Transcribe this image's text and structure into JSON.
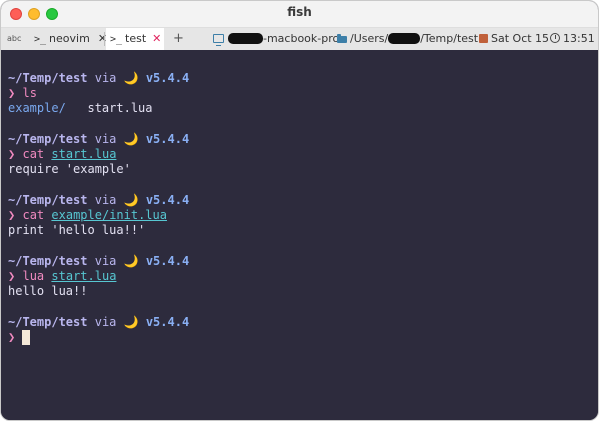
{
  "window": {
    "title": "fish"
  },
  "tabs": {
    "input_indicator": "abc",
    "items": [
      {
        "glyph": ">_",
        "label": "neovim",
        "close": "✕",
        "active": false
      },
      {
        "glyph": ">_",
        "label": "test",
        "close": "✕",
        "active": true
      }
    ],
    "new_tab": "+"
  },
  "status": {
    "host_suffix": "-macbook-pro",
    "path_prefix": "/Users/",
    "path_suffix": "/Temp/test",
    "date": "Sat Oct 15",
    "time": "13:51",
    "icons": {
      "host": "monitor-icon",
      "path": "folder-icon",
      "date": "calendar-icon",
      "time": "clock-icon"
    },
    "colors": {
      "close_x": "#e0245e",
      "icon": "#3d7fa8"
    }
  },
  "terminal": {
    "background": "#2d2b3d",
    "prompt_char": "❯",
    "prompt": {
      "path": "~/Temp/test",
      "via": "via",
      "moon": "🌙",
      "version": "v5.4.4"
    },
    "blocks": [
      {
        "cmd": "ls",
        "arg": "",
        "output": [
          {
            "a": "example/",
            "b": "start.lua"
          }
        ]
      },
      {
        "cmd": "cat",
        "arg": "start.lua",
        "output": "require 'example'"
      },
      {
        "cmd": "cat",
        "arg": "example/init.lua",
        "output": "print 'hello lua!!'"
      },
      {
        "cmd": "lua",
        "arg": "start.lua",
        "output": "hello lua!!"
      }
    ]
  }
}
